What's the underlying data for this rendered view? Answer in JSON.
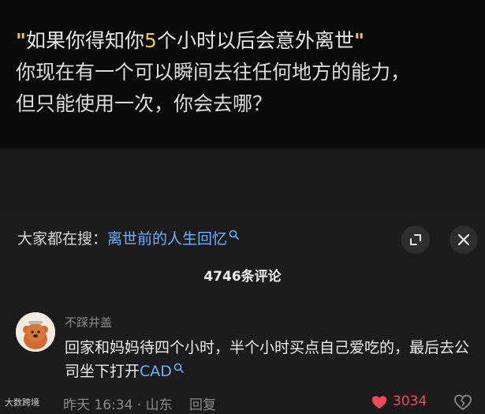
{
  "caption": {
    "open_quote": "\"",
    "l1a": "如果你得知你",
    "l1num": "5",
    "l1b": "个小时以后会意外离世",
    "close_quote": "\"",
    "line2": "你现在有一个可以瞬间去往任何地方的能力，",
    "line3": "但只能使用一次，你会去哪？"
  },
  "search": {
    "prefix": "大家都在搜：",
    "query": "离世前的人生回忆"
  },
  "comments_count": "4746条评论",
  "comment": {
    "user": "不踩井盖",
    "text": "回家和妈妈待四个小时，半个小时买点自己爱吃的，最后去公司坐下打开",
    "cad": "CAD",
    "time_location": "昨天 16:34 · 山东",
    "reply": "回复",
    "likes": "3034"
  },
  "watermark": "大数跨境",
  "icons": [
    "search-icon",
    "expand-icon",
    "close-icon",
    "heart-icon",
    "dislike-icon"
  ],
  "colors": {
    "accent_link": "#6fb1ff",
    "like": "#f04a5c",
    "caption_quote": "#f1c84b"
  }
}
